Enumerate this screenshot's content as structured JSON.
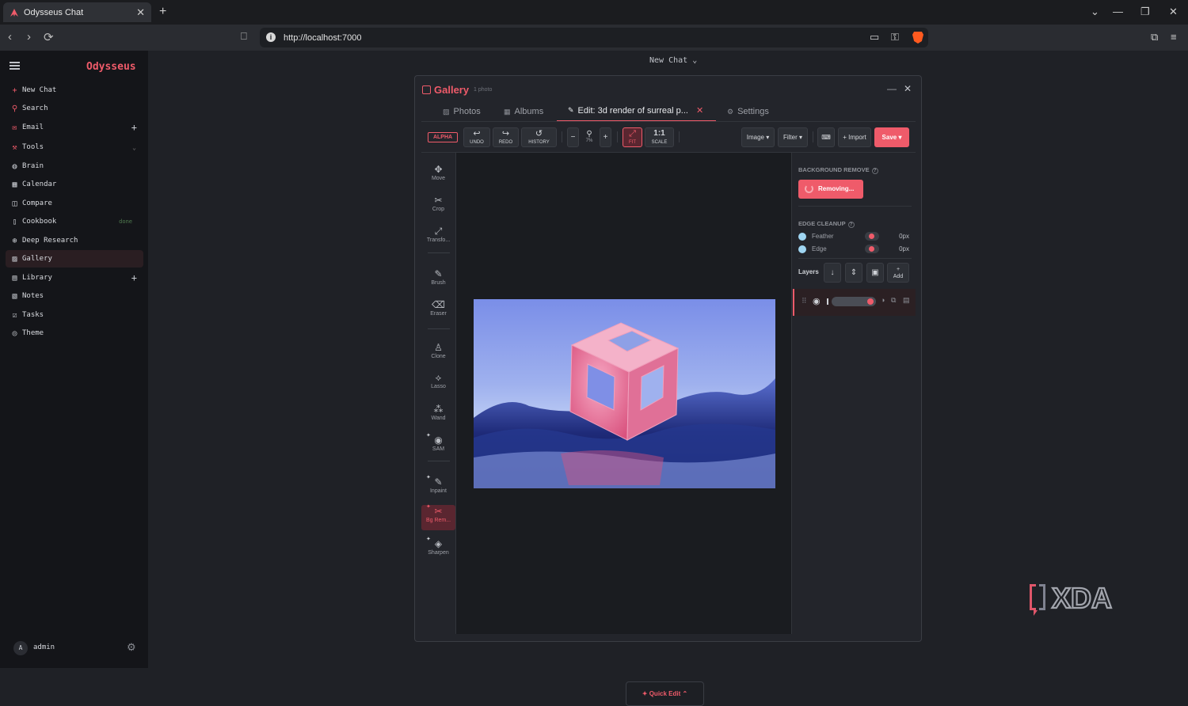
{
  "browser": {
    "tab_title": "Odysseus Chat",
    "url": "http://localhost:7000"
  },
  "sidebar": {
    "brand": "Odysseus",
    "items": [
      {
        "label": "New Chat",
        "icon": "plus-icon"
      },
      {
        "label": "Search",
        "icon": "search-icon"
      },
      {
        "label": "Email",
        "icon": "mail-icon"
      },
      {
        "label": "Tools",
        "icon": "wrench-icon"
      },
      {
        "label": "Brain",
        "icon": "brain-icon"
      },
      {
        "label": "Calendar",
        "icon": "calendar-icon"
      },
      {
        "label": "Compare",
        "icon": "columns-icon"
      },
      {
        "label": "Cookbook",
        "icon": "book-icon",
        "status": "done"
      },
      {
        "label": "Deep Research",
        "icon": "research-icon"
      },
      {
        "label": "Gallery",
        "icon": "image-icon"
      },
      {
        "label": "Library",
        "icon": "library-icon"
      },
      {
        "label": "Notes",
        "icon": "notes-icon"
      },
      {
        "label": "Tasks",
        "icon": "tasks-icon"
      },
      {
        "label": "Theme",
        "icon": "palette-icon"
      }
    ],
    "user": {
      "initial": "A",
      "name": "admin"
    }
  },
  "main": {
    "chat_title": "New Chat"
  },
  "gallery": {
    "title": "Gallery",
    "count": "1 photo",
    "tabs": [
      {
        "label": "Photos"
      },
      {
        "label": "Albums"
      },
      {
        "label": "Edit: 3d render of surreal p..."
      },
      {
        "label": "Settings"
      }
    ],
    "toolbar": {
      "alpha": "ALPHA",
      "undo": "UNDO",
      "redo": "REDO",
      "history": "HISTORY",
      "zoom_out": "−",
      "zoom_level": "7%",
      "zoom_in": "+",
      "fit": "FIT",
      "scale_top": "1:1",
      "scale": "SCALE",
      "image": "Image ▾",
      "filter": "Filter ▾",
      "import": "+ Import",
      "save": "Save ▾"
    },
    "tools": [
      {
        "label": "Move"
      },
      {
        "label": "Crop"
      },
      {
        "label": "Transfo..."
      },
      {
        "label": "Brush"
      },
      {
        "label": "Eraser"
      },
      {
        "label": "Clone"
      },
      {
        "label": "Lasso"
      },
      {
        "label": "Wand"
      },
      {
        "label": "SAM"
      },
      {
        "label": "Inpaint"
      },
      {
        "label": "Bg Rem..."
      },
      {
        "label": "Sharpen"
      }
    ],
    "quick_edit": "✦ Quick Edit ⌃",
    "panel": {
      "bg_remove_title": "BACKGROUND REMOVE",
      "removing": "Removing...",
      "edge_cleanup_title": "EDGE CLEANUP",
      "feather_label": "Feather",
      "feather_value": "0px",
      "edge_label": "Edge",
      "edge_value": "0px",
      "layers_label": "Layers",
      "add_label": "Add"
    }
  },
  "watermark": "XDA",
  "colors": {
    "accent": "#ef5b6a",
    "sidebar_bg": "#141519",
    "page_bg": "#1f2126"
  }
}
